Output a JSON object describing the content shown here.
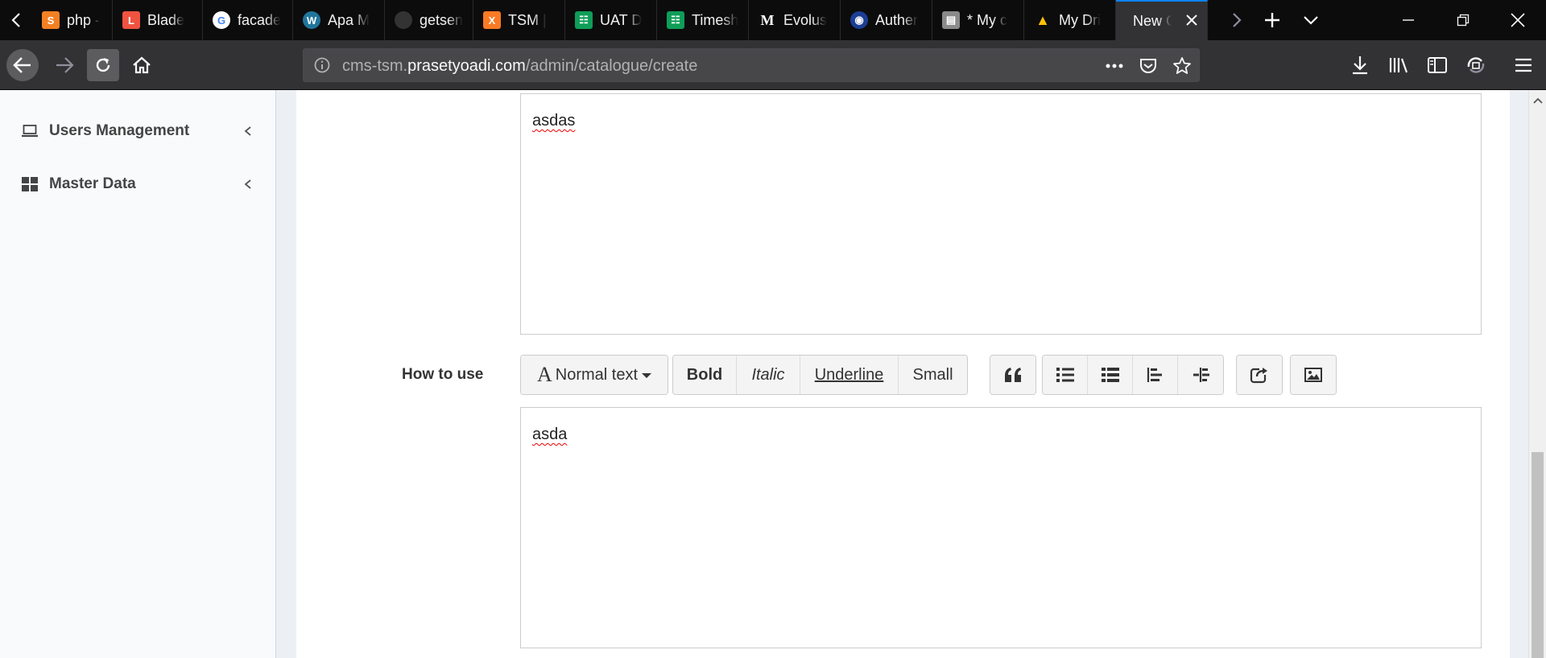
{
  "tabs": [
    {
      "title": "php - ",
      "favicon": "stackoverflow-icon",
      "color": "#f48024"
    },
    {
      "title": "Blade ",
      "favicon": "laravel-icon",
      "color": "#f05340"
    },
    {
      "title": "facade",
      "favicon": "google-icon",
      "color": "#ffffff"
    },
    {
      "title": "Apa M",
      "favicon": "wordpress-icon",
      "color": "#21759b"
    },
    {
      "title": "getsen",
      "favicon": "github-icon",
      "color": "#333333"
    },
    {
      "title": "TSM | ",
      "favicon": "xampp-icon",
      "color": "#fb7a24"
    },
    {
      "title": "UAT D",
      "favicon": "sheets-icon",
      "color": "#0f9d58"
    },
    {
      "title": "Timesh",
      "favicon": "sheets-icon",
      "color": "#0f9d58"
    },
    {
      "title": "Evolus",
      "favicon": "medium-icon",
      "color": "#000000"
    },
    {
      "title": "Auther",
      "favicon": "globe-icon",
      "color": "#1c3f94"
    },
    {
      "title": "* My c",
      "favicon": "trello-icon",
      "color": "#8a8a8a"
    },
    {
      "title": "My Dri",
      "favicon": "drive-icon",
      "color": "#ffc107"
    },
    {
      "title": "New Ca",
      "favicon": "none",
      "color": "#323234",
      "active": true
    }
  ],
  "url": {
    "prefix": "cms-tsm.",
    "domain": "prasetyoadi.com",
    "path": "/admin/catalogue/create"
  },
  "sidebar": {
    "items": [
      {
        "label": "Users Management",
        "icon": "laptop-icon"
      },
      {
        "label": "Master Data",
        "icon": "grid-icon"
      }
    ]
  },
  "form": {
    "description_value": "asdas",
    "how_to_use_label": "How to use",
    "how_to_use_value": "asda"
  },
  "toolbar": {
    "heading_label": "Normal text",
    "bold_label": "Bold",
    "italic_label": "Italic",
    "underline_label": "Underline",
    "small_label": "Small"
  },
  "colors": {
    "accent": "#0a84ff",
    "tabstrip": "#0c0c0d",
    "navbar": "#323234",
    "sidebar_bg": "#f9fafc",
    "page_bg": "#ecf0f5"
  }
}
